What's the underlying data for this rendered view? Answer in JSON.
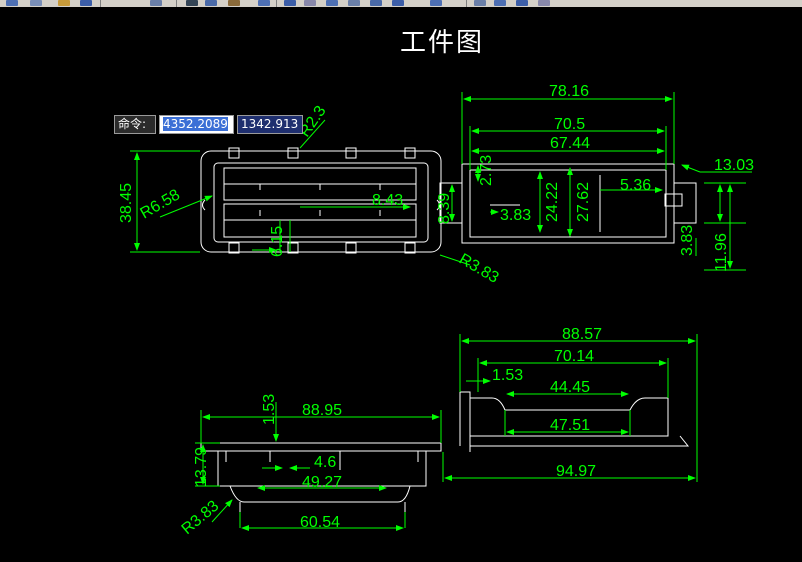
{
  "title": "工件图",
  "command": {
    "label": "命令:",
    "x": "4352.2089",
    "y": "1342.913"
  },
  "colors": {
    "background": "#000000",
    "dimension": "#00ff00",
    "outline": "#ffffff"
  },
  "dimensions": {
    "top_left": {
      "width": "38.45",
      "radius_left": "R6.58",
      "radius_top": "R2.3",
      "radius_bottom": "R3.83",
      "inner": "8.43",
      "pitch": "6.15"
    },
    "top_right": {
      "overall": "78.16",
      "inner1": "70.5",
      "inner2": "67.44",
      "step": "13.03",
      "h1": "8.39",
      "h2": "24.22",
      "h3": "27.62",
      "h4": "2.73",
      "w1": "3.83",
      "w2": "5.36",
      "w3": "3.83",
      "h5": "11.96"
    },
    "bottom_left": {
      "overall": "88.95",
      "lip": "1.53",
      "height": "13.79",
      "gap": "4.6",
      "inner": "49.27",
      "base": "60.54",
      "radius": "R3.83"
    },
    "bottom_right": {
      "overall": "88.57",
      "inner": "70.14",
      "lip": "1.53",
      "slot": "44.45",
      "slot2": "47.51",
      "total": "94.97"
    }
  }
}
